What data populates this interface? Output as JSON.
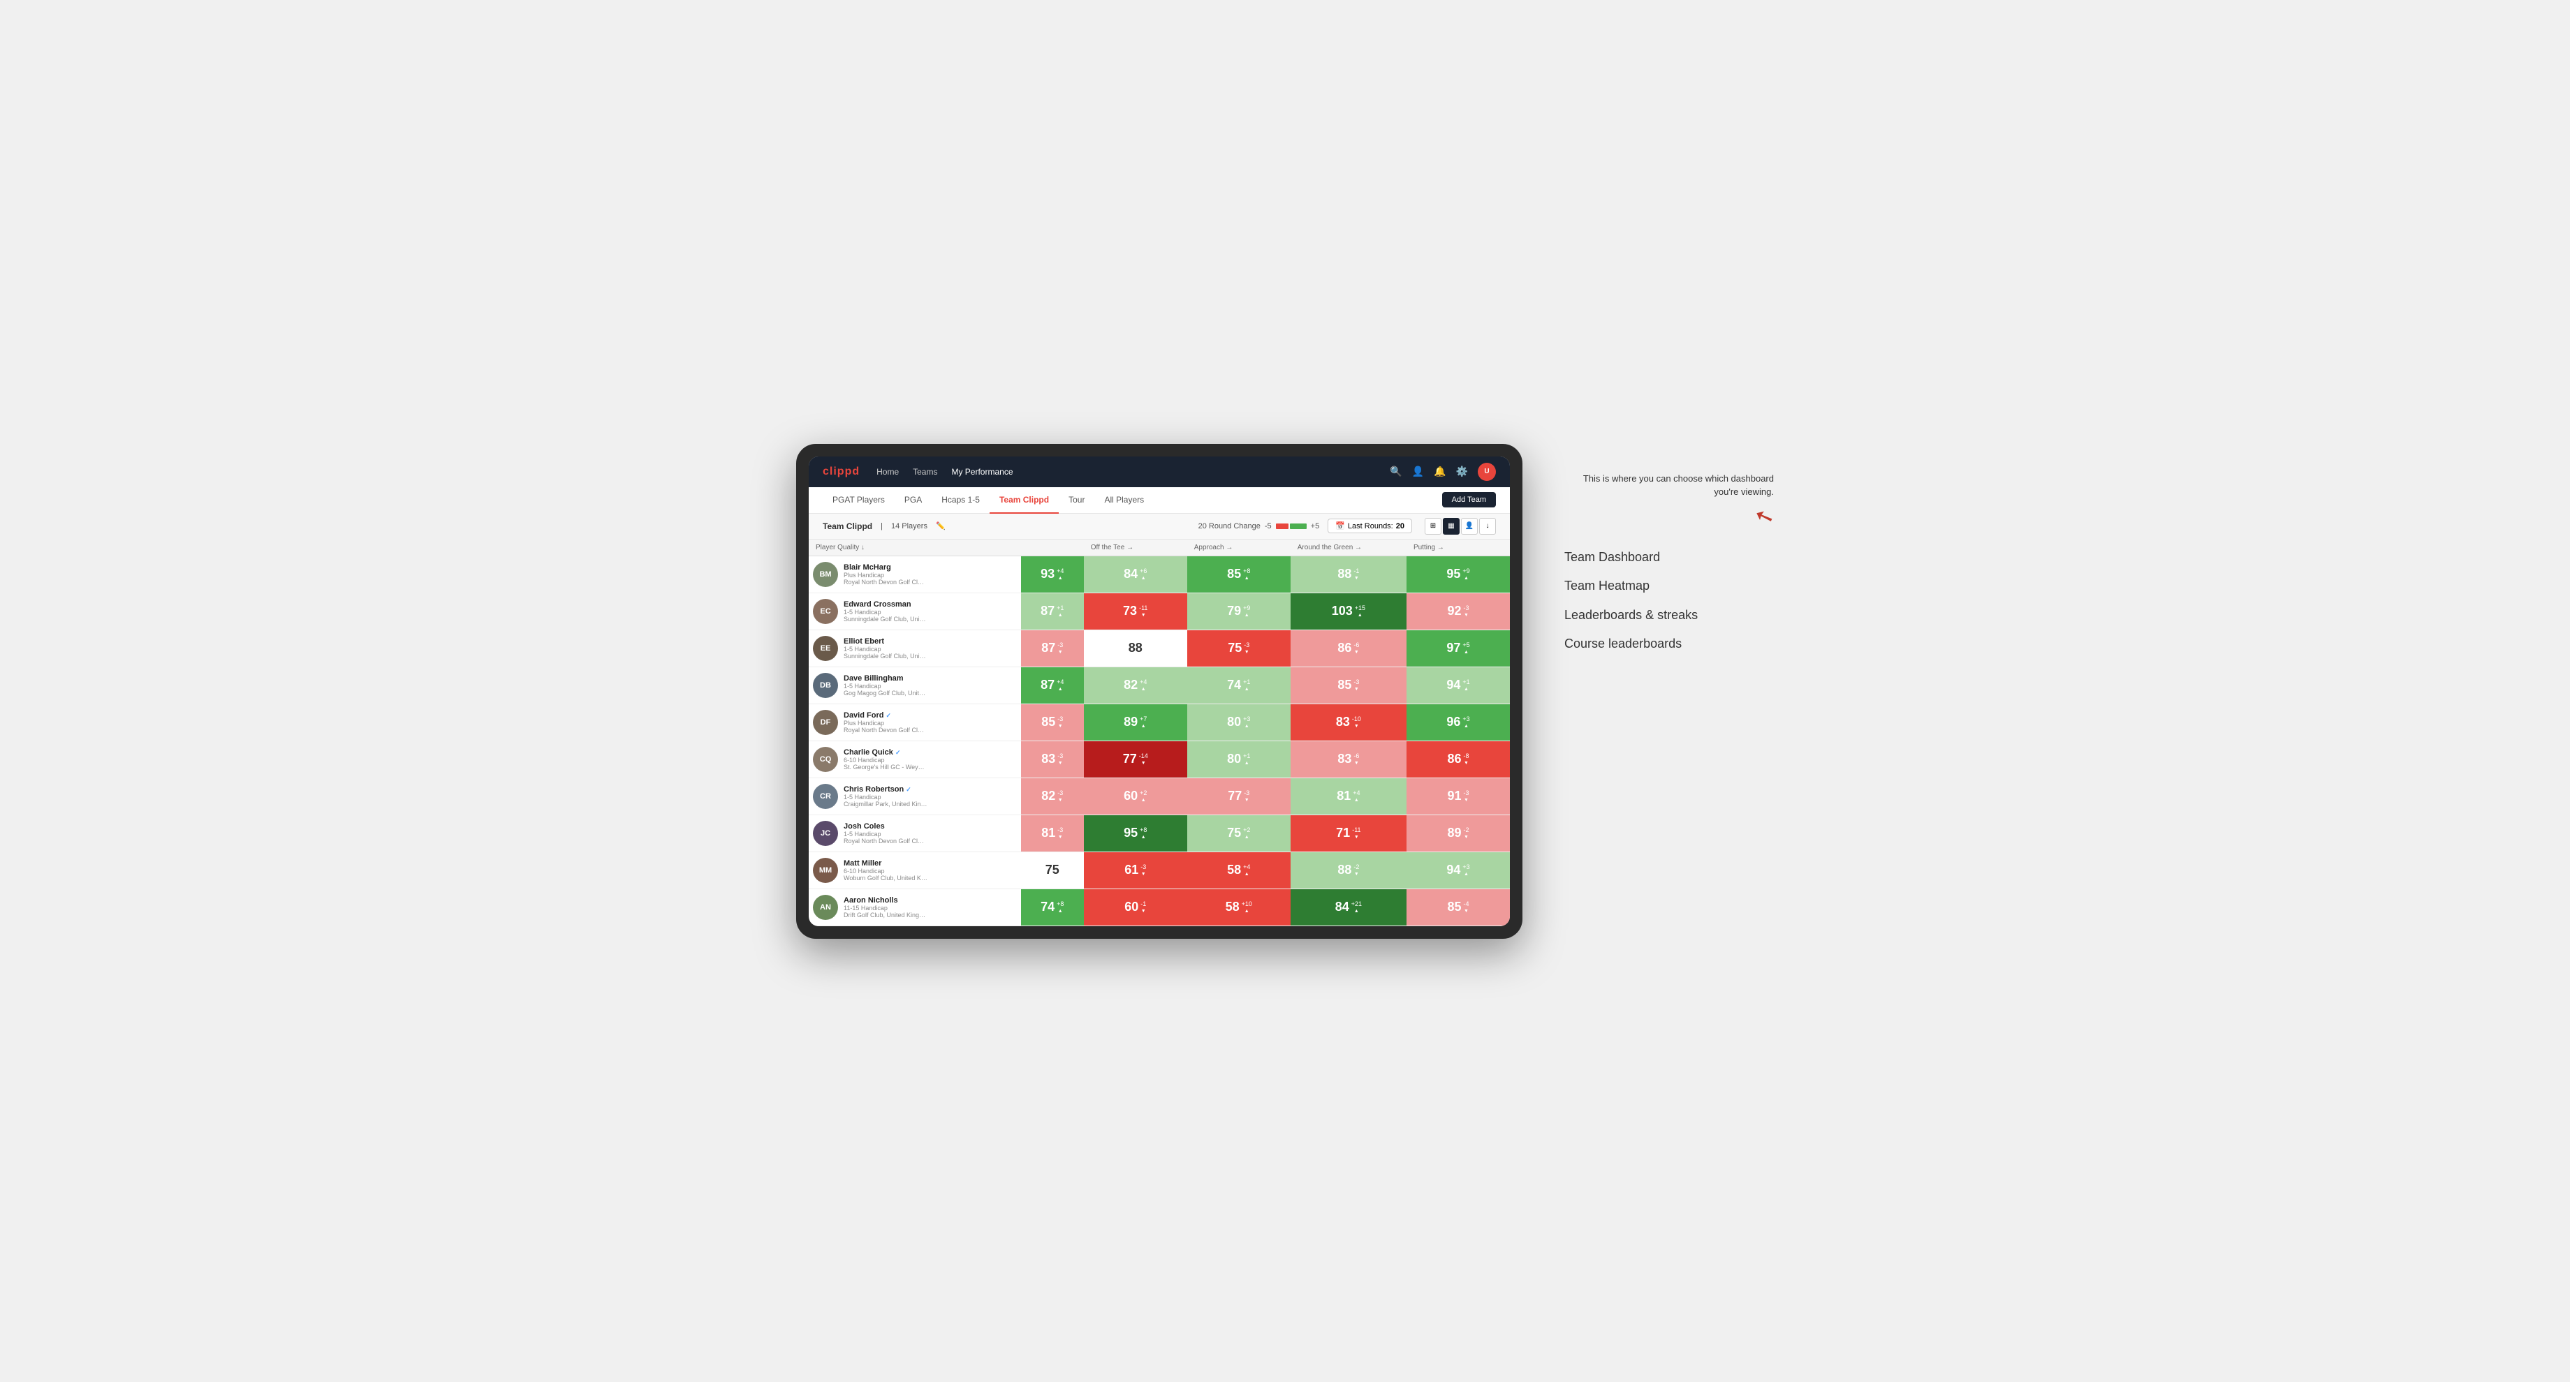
{
  "annotation": {
    "description": "This is where you can choose which dashboard you're viewing.",
    "items": [
      "Team Dashboard",
      "Team Heatmap",
      "Leaderboards & streaks",
      "Course leaderboards"
    ]
  },
  "nav": {
    "logo": "clippd",
    "links": [
      "Home",
      "Teams",
      "My Performance"
    ],
    "active_link": "My Performance"
  },
  "tabs": {
    "items": [
      "PGAT Players",
      "PGA",
      "Hcaps 1-5",
      "Team Clippd",
      "Tour",
      "All Players"
    ],
    "active": "Team Clippd",
    "add_team_label": "Add Team"
  },
  "toolbar": {
    "team_name": "Team Clippd",
    "player_count": "14 Players",
    "round_change_label": "20 Round Change",
    "minus_label": "-5",
    "plus_label": "+5",
    "last_rounds_label": "Last Rounds:",
    "last_rounds_value": "20"
  },
  "table": {
    "headers": {
      "player": "Player Quality ↓",
      "off_tee": "Off the Tee →",
      "approach": "Approach →",
      "around_green": "Around the Green →",
      "putting": "Putting →"
    },
    "players": [
      {
        "name": "Blair McHarg",
        "handicap": "Plus Handicap",
        "club": "Royal North Devon Golf Club, United Kingdom",
        "avatar_color": "#7a8c6e",
        "initials": "BM",
        "scores": {
          "player_quality": {
            "value": 93,
            "change": "+4",
            "direction": "up",
            "color": "green"
          },
          "off_tee": {
            "value": 84,
            "change": "+6",
            "direction": "up",
            "color": "light-green"
          },
          "approach": {
            "value": 85,
            "change": "+8",
            "direction": "up",
            "color": "green"
          },
          "around_green": {
            "value": 88,
            "change": "-1",
            "direction": "down",
            "color": "light-green"
          },
          "putting": {
            "value": 95,
            "change": "+9",
            "direction": "up",
            "color": "green"
          }
        }
      },
      {
        "name": "Edward Crossman",
        "handicap": "1-5 Handicap",
        "club": "Sunningdale Golf Club, United Kingdom",
        "avatar_color": "#8a7060",
        "initials": "EC",
        "scores": {
          "player_quality": {
            "value": 87,
            "change": "+1",
            "direction": "up",
            "color": "light-green"
          },
          "off_tee": {
            "value": 73,
            "change": "-11",
            "direction": "down",
            "color": "red"
          },
          "approach": {
            "value": 79,
            "change": "+9",
            "direction": "up",
            "color": "light-green"
          },
          "around_green": {
            "value": 103,
            "change": "+15",
            "direction": "up",
            "color": "dark-green"
          },
          "putting": {
            "value": 92,
            "change": "-3",
            "direction": "down",
            "color": "light-red"
          }
        }
      },
      {
        "name": "Elliot Ebert",
        "handicap": "1-5 Handicap",
        "club": "Sunningdale Golf Club, United Kingdom",
        "avatar_color": "#6a5a4a",
        "initials": "EE",
        "scores": {
          "player_quality": {
            "value": 87,
            "change": "-3",
            "direction": "down",
            "color": "light-red"
          },
          "off_tee": {
            "value": 88,
            "change": "",
            "direction": "",
            "color": "white"
          },
          "approach": {
            "value": 75,
            "change": "-3",
            "direction": "down",
            "color": "red"
          },
          "around_green": {
            "value": 86,
            "change": "-6",
            "direction": "down",
            "color": "light-red"
          },
          "putting": {
            "value": 97,
            "change": "+5",
            "direction": "up",
            "color": "green"
          }
        }
      },
      {
        "name": "Dave Billingham",
        "handicap": "1-5 Handicap",
        "club": "Gog Magog Golf Club, United Kingdom",
        "avatar_color": "#5a6a7a",
        "initials": "DB",
        "scores": {
          "player_quality": {
            "value": 87,
            "change": "+4",
            "direction": "up",
            "color": "green"
          },
          "off_tee": {
            "value": 82,
            "change": "+4",
            "direction": "up",
            "color": "light-green"
          },
          "approach": {
            "value": 74,
            "change": "+1",
            "direction": "up",
            "color": "light-green"
          },
          "around_green": {
            "value": 85,
            "change": "-3",
            "direction": "down",
            "color": "light-red"
          },
          "putting": {
            "value": 94,
            "change": "+1",
            "direction": "up",
            "color": "light-green"
          }
        }
      },
      {
        "name": "David Ford",
        "handicap": "Plus Handicap",
        "club": "Royal North Devon Golf Club, United Kingdom",
        "avatar_color": "#7a6a5a",
        "initials": "DF",
        "verified": true,
        "scores": {
          "player_quality": {
            "value": 85,
            "change": "-3",
            "direction": "down",
            "color": "light-red"
          },
          "off_tee": {
            "value": 89,
            "change": "+7",
            "direction": "up",
            "color": "green"
          },
          "approach": {
            "value": 80,
            "change": "+3",
            "direction": "up",
            "color": "light-green"
          },
          "around_green": {
            "value": 83,
            "change": "-10",
            "direction": "down",
            "color": "red"
          },
          "putting": {
            "value": 96,
            "change": "+3",
            "direction": "up",
            "color": "green"
          }
        }
      },
      {
        "name": "Charlie Quick",
        "handicap": "6-10 Handicap",
        "club": "St. George's Hill GC - Weybridge - Surrey, Uni...",
        "avatar_color": "#8a7a6a",
        "initials": "CQ",
        "verified": true,
        "scores": {
          "player_quality": {
            "value": 83,
            "change": "-3",
            "direction": "down",
            "color": "light-red"
          },
          "off_tee": {
            "value": 77,
            "change": "-14",
            "direction": "down",
            "color": "dark-red"
          },
          "approach": {
            "value": 80,
            "change": "+1",
            "direction": "up",
            "color": "light-green"
          },
          "around_green": {
            "value": 83,
            "change": "-6",
            "direction": "down",
            "color": "light-red"
          },
          "putting": {
            "value": 86,
            "change": "-8",
            "direction": "down",
            "color": "red"
          }
        }
      },
      {
        "name": "Chris Robertson",
        "handicap": "1-5 Handicap",
        "club": "Craigmillar Park, United Kingdom",
        "avatar_color": "#6a7a8a",
        "initials": "CR",
        "verified": true,
        "scores": {
          "player_quality": {
            "value": 82,
            "change": "-3",
            "direction": "down",
            "color": "light-red"
          },
          "off_tee": {
            "value": 60,
            "change": "+2",
            "direction": "up",
            "color": "light-red"
          },
          "approach": {
            "value": 77,
            "change": "-3",
            "direction": "down",
            "color": "light-red"
          },
          "around_green": {
            "value": 81,
            "change": "+4",
            "direction": "up",
            "color": "light-green"
          },
          "putting": {
            "value": 91,
            "change": "-3",
            "direction": "down",
            "color": "light-red"
          }
        }
      },
      {
        "name": "Josh Coles",
        "handicap": "1-5 Handicap",
        "club": "Royal North Devon Golf Club, United Kingdom",
        "avatar_color": "#5a4a6a",
        "initials": "JC",
        "scores": {
          "player_quality": {
            "value": 81,
            "change": "-3",
            "direction": "down",
            "color": "light-red"
          },
          "off_tee": {
            "value": 95,
            "change": "+8",
            "direction": "up",
            "color": "dark-green"
          },
          "approach": {
            "value": 75,
            "change": "+2",
            "direction": "up",
            "color": "light-green"
          },
          "around_green": {
            "value": 71,
            "change": "-11",
            "direction": "down",
            "color": "red"
          },
          "putting": {
            "value": 89,
            "change": "-2",
            "direction": "down",
            "color": "light-red"
          }
        }
      },
      {
        "name": "Matt Miller",
        "handicap": "6-10 Handicap",
        "club": "Woburn Golf Club, United Kingdom",
        "avatar_color": "#7a5a4a",
        "initials": "MM",
        "scores": {
          "player_quality": {
            "value": 75,
            "change": "",
            "direction": "",
            "color": "white"
          },
          "off_tee": {
            "value": 61,
            "change": "-3",
            "direction": "down",
            "color": "red"
          },
          "approach": {
            "value": 58,
            "change": "+4",
            "direction": "up",
            "color": "red"
          },
          "around_green": {
            "value": 88,
            "change": "-2",
            "direction": "down",
            "color": "light-green"
          },
          "putting": {
            "value": 94,
            "change": "+3",
            "direction": "up",
            "color": "light-green"
          }
        }
      },
      {
        "name": "Aaron Nicholls",
        "handicap": "11-15 Handicap",
        "club": "Drift Golf Club, United Kingdom",
        "avatar_color": "#6a8a5a",
        "initials": "AN",
        "scores": {
          "player_quality": {
            "value": 74,
            "change": "+8",
            "direction": "up",
            "color": "green"
          },
          "off_tee": {
            "value": 60,
            "change": "-1",
            "direction": "down",
            "color": "red"
          },
          "approach": {
            "value": 58,
            "change": "+10",
            "direction": "up",
            "color": "red"
          },
          "around_green": {
            "value": 84,
            "change": "+21",
            "direction": "up",
            "color": "dark-green"
          },
          "putting": {
            "value": 85,
            "change": "-4",
            "direction": "down",
            "color": "light-red"
          }
        }
      }
    ]
  }
}
